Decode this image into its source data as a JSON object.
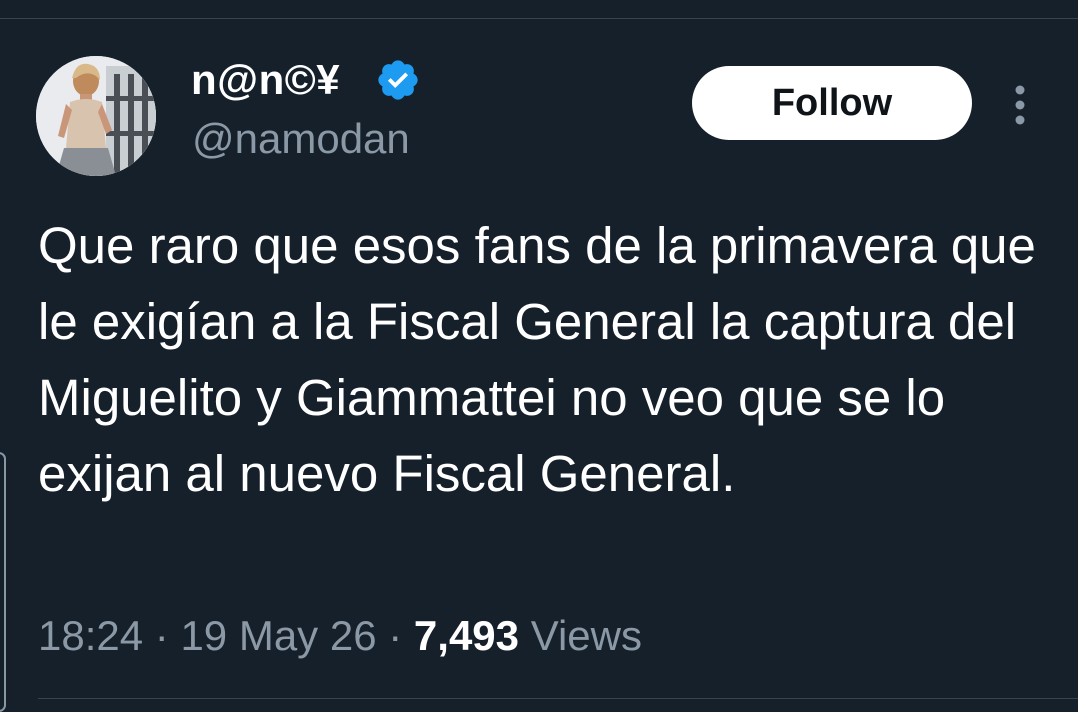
{
  "author": {
    "display_name": "n@n©¥",
    "handle": "@namodan",
    "verified": true,
    "avatar_icon": "profile-photo"
  },
  "actions": {
    "follow_label": "Follow",
    "more_icon": "vertical-ellipsis-icon"
  },
  "tweet": {
    "text": "Que raro que esos fans de la primavera que le exigían a la Fiscal General la captura del Miguelito y Giammattei no veo que se lo exijan al nuevo Fiscal General.",
    "time": "18:24",
    "separator": "·",
    "date": "19 May 26",
    "views_count": "7,493",
    "views_label": "Views"
  },
  "colors": {
    "background": "#15202b",
    "text_primary": "#ffffff",
    "text_secondary": "#8b98a5",
    "verified_badge": "#1d9bf0",
    "follow_button_bg": "#ffffff",
    "follow_button_text": "#0f1419",
    "divider": "#38444d"
  }
}
